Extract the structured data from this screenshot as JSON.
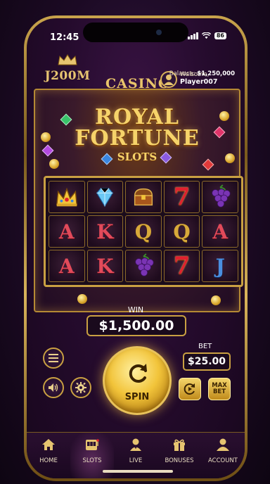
{
  "status_bar": {
    "time": "12:45",
    "battery": "86"
  },
  "header": {
    "logo_text": "J200M",
    "casino_label": "CASINO",
    "user": {
      "welcome": "Walsome,",
      "name": "Player007"
    },
    "balance_label": "Balance:",
    "balance_value": "$1,250,000"
  },
  "game": {
    "title_line1": "ROYAL",
    "title_line2": "FORTUNE",
    "title_line3": "SLOTS",
    "reels": [
      [
        "crown",
        "diamond",
        "chest",
        "seven",
        "grapes"
      ],
      [
        "A",
        "K",
        "Q",
        "Q",
        "A"
      ],
      [
        "A",
        "K",
        "grapes",
        "seven",
        "J"
      ]
    ],
    "seven_glyph": "7"
  },
  "win": {
    "label": "WIN",
    "amount": "$1,500.00"
  },
  "controls": {
    "bet_label": "BET",
    "bet_amount": "$25.00",
    "spin_label": "SPIN",
    "max_bet_label": "MAX BET"
  },
  "nav": {
    "items": [
      {
        "label": "HOME",
        "icon": "home-icon"
      },
      {
        "label": "SLOTS",
        "icon": "slot-machine-icon"
      },
      {
        "label": "LIVE",
        "icon": "live-dealer-icon"
      },
      {
        "label": "BONUSES",
        "icon": "gift-icon"
      },
      {
        "label": "ACCOUNT",
        "icon": "account-icon"
      }
    ],
    "active_index": 1
  },
  "colors": {
    "gold": "#c9a042",
    "bg_purple": "#250b2d",
    "accent_red": "#e24a5a"
  }
}
